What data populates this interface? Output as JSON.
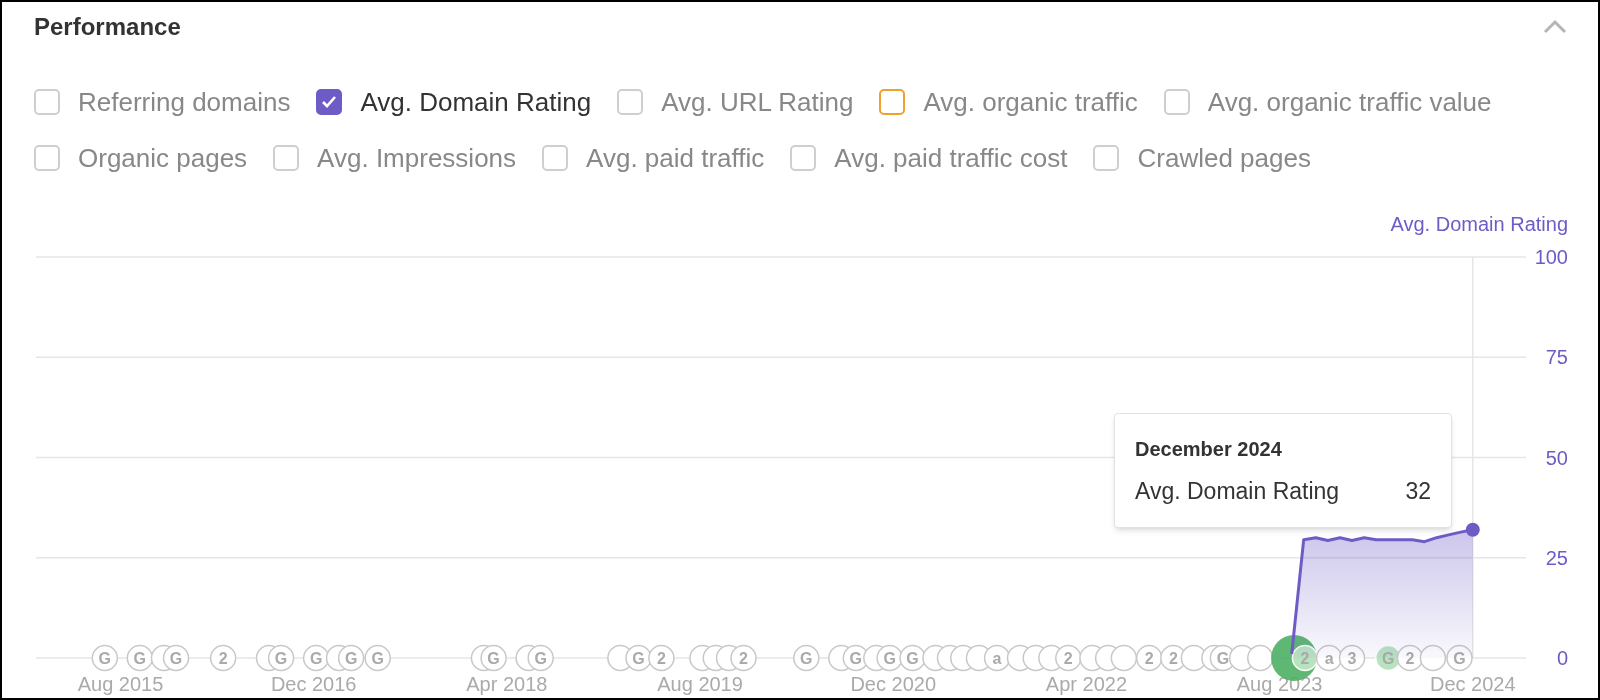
{
  "panel": {
    "title": "Performance",
    "expanded": true
  },
  "legend": [
    {
      "label": "Referring domains",
      "checked": false,
      "color": "#cfcfcf"
    },
    {
      "label": "Avg. Domain Rating",
      "checked": true,
      "color": "#6f5bc6"
    },
    {
      "label": "Avg. URL Rating",
      "checked": false,
      "color": "#cfcfcf"
    },
    {
      "label": "Avg. organic traffic",
      "checked": false,
      "color": "#f0a030"
    },
    {
      "label": "Avg. organic traffic value",
      "checked": false,
      "color": "#cfcfcf"
    },
    {
      "label": "Organic pages",
      "checked": false,
      "color": "#cfcfcf"
    },
    {
      "label": "Avg. Impressions",
      "checked": false,
      "color": "#cfcfcf"
    },
    {
      "label": "Avg. paid traffic",
      "checked": false,
      "color": "#cfcfcf"
    },
    {
      "label": "Avg. paid traffic cost",
      "checked": false,
      "color": "#cfcfcf"
    },
    {
      "label": "Crawled pages",
      "checked": false,
      "color": "#cfcfcf"
    }
  ],
  "chart": {
    "chart_data": {
      "type": "line",
      "categories": [
        null,
        null,
        "Aug 2015",
        null,
        null,
        null,
        null,
        null,
        null,
        null,
        null,
        null,
        null,
        null,
        null,
        null,
        null,
        null,
        "Dec 2016",
        null,
        null,
        null,
        null,
        null,
        null,
        null,
        null,
        null,
        null,
        null,
        null,
        null,
        null,
        null,
        "Apr 2018",
        null,
        null,
        null,
        null,
        null,
        null,
        null,
        null,
        null,
        null,
        null,
        null,
        null,
        null,
        null,
        "Aug 2019",
        null,
        null,
        null,
        null,
        null,
        null,
        null,
        null,
        null,
        null,
        null,
        null,
        null,
        null,
        null,
        "Dec 2020",
        null,
        null,
        null,
        null,
        null,
        null,
        null,
        null,
        null,
        null,
        null,
        null,
        null,
        null,
        null,
        "Apr 2022",
        null,
        null,
        null,
        null,
        null,
        null,
        null,
        null,
        null,
        null,
        null,
        null,
        null,
        null,
        null,
        "Aug 2023",
        null,
        null,
        null,
        null,
        null,
        null,
        null,
        null,
        null,
        null,
        null,
        null,
        null,
        null,
        null,
        "Dec 2024"
      ],
      "series": [
        {
          "name": "Avg. Domain Rating",
          "color": "#6f5bc6",
          "values": [
            null,
            null,
            null,
            null,
            null,
            null,
            null,
            null,
            null,
            null,
            null,
            null,
            null,
            null,
            null,
            null,
            null,
            null,
            null,
            null,
            null,
            null,
            null,
            null,
            null,
            null,
            null,
            null,
            null,
            null,
            null,
            null,
            null,
            null,
            null,
            null,
            null,
            null,
            null,
            null,
            null,
            null,
            null,
            null,
            null,
            null,
            null,
            null,
            null,
            null,
            null,
            null,
            null,
            null,
            null,
            null,
            null,
            null,
            null,
            null,
            null,
            null,
            null,
            null,
            null,
            null,
            null,
            null,
            null,
            null,
            null,
            null,
            null,
            null,
            null,
            null,
            null,
            null,
            null,
            null,
            null,
            null,
            null,
            null,
            null,
            null,
            null,
            null,
            null,
            null,
            null,
            null,
            null,
            null,
            null,
            null,
            null,
            null,
            null,
            1,
            29.5,
            30,
            29.3,
            30,
            29.3,
            30,
            29.5,
            29.5,
            29.5,
            29.5,
            29,
            30,
            30.7,
            31.4,
            32
          ]
        }
      ],
      "ylim": [
        0,
        100
      ],
      "grid": true,
      "yticks": [
        0,
        25,
        50,
        75,
        100
      ]
    },
    "tooltip": {
      "title": "December 2024",
      "label": "Avg. Domain Rating",
      "value": "32"
    },
    "events": [
      {
        "label": "G",
        "kind": "plain"
      },
      {
        "label": "G",
        "kind": "plain"
      },
      {
        "kind": "plain"
      },
      {
        "label": "G",
        "kind": "plain"
      },
      {
        "label": "2",
        "kind": "plain"
      },
      {
        "kind": "plain"
      },
      {
        "label": "G",
        "kind": "plain"
      },
      {
        "label": "G",
        "kind": "plain"
      },
      {
        "kind": "plain"
      },
      {
        "label": "G",
        "kind": "plain"
      },
      {
        "label": "G",
        "kind": "plain"
      },
      {
        "kind": "plain"
      },
      {
        "label": "G",
        "kind": "plain"
      },
      {
        "kind": "plain"
      },
      {
        "label": "G",
        "kind": "plain"
      },
      {
        "kind": "plain"
      },
      {
        "label": "G",
        "kind": "plain"
      },
      {
        "label": "2",
        "kind": "plain"
      },
      {
        "kind": "plain"
      },
      {
        "kind": "plain"
      },
      {
        "kind": "plain"
      },
      {
        "label": "2",
        "kind": "plain"
      },
      {
        "label": "G",
        "kind": "plain"
      },
      {
        "kind": "plain"
      },
      {
        "label": "G",
        "kind": "plain"
      },
      {
        "kind": "plain"
      },
      {
        "label": "G",
        "kind": "plain"
      },
      {
        "label": "G",
        "kind": "plain"
      },
      {
        "kind": "plain"
      },
      {
        "kind": "plain"
      },
      {
        "kind": "plain"
      },
      {
        "kind": "plain"
      },
      {
        "label": "a",
        "kind": "plain"
      },
      {
        "kind": "plain"
      },
      {
        "kind": "plain"
      },
      {
        "kind": "plain"
      },
      {
        "label": "2",
        "kind": "plain"
      },
      {
        "kind": "plain"
      },
      {
        "kind": "plain"
      },
      {
        "kind": "plain"
      },
      {
        "label": "2",
        "kind": "plain"
      },
      {
        "label": "2",
        "kind": "plain"
      },
      {
        "kind": "plain"
      },
      {
        "kind": "plain"
      },
      {
        "label": "G",
        "kind": "plain"
      },
      {
        "kind": "plain"
      },
      {
        "kind": "plain"
      },
      {
        "kind": "highlight"
      },
      {
        "label": "2",
        "kind": "tinted"
      },
      {
        "label": "a",
        "kind": "plain"
      },
      {
        "label": "3",
        "kind": "plain"
      },
      {
        "label": "G",
        "kind": "tinted"
      },
      {
        "label": "2",
        "kind": "plain"
      },
      {
        "kind": "plain"
      },
      {
        "label": "G",
        "kind": "plain"
      }
    ]
  }
}
